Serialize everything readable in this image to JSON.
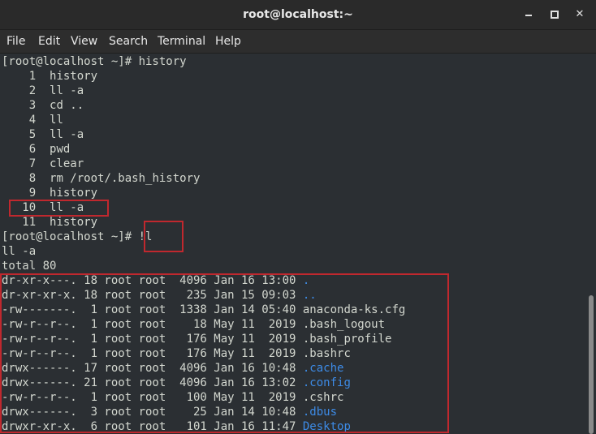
{
  "window": {
    "title": "root@localhost:~"
  },
  "menu": [
    "File",
    "Edit",
    "View",
    "Search",
    "Terminal",
    "Help"
  ],
  "terminal": {
    "prompt_history": "[root@localhost ~]# history",
    "history": [
      {
        "num": "1",
        "cmd": "history"
      },
      {
        "num": "2",
        "cmd": "ll -a"
      },
      {
        "num": "3",
        "cmd": "cd .."
      },
      {
        "num": "4",
        "cmd": "ll"
      },
      {
        "num": "5",
        "cmd": "ll -a"
      },
      {
        "num": "6",
        "cmd": "pwd"
      },
      {
        "num": "7",
        "cmd": "clear"
      },
      {
        "num": "8",
        "cmd": "rm /root/.bash_history"
      },
      {
        "num": "9",
        "cmd": "history"
      },
      {
        "num": "10",
        "cmd": "ll -a"
      },
      {
        "num": "11",
        "cmd": "history"
      }
    ],
    "prompt_bang": "[root@localhost ~]# ",
    "bang_cmd": "!l",
    "echo": "ll -a",
    "total": "total 80",
    "listing": [
      {
        "perm": "dr-xr-x---.",
        "links": "18",
        "user": "root",
        "group": "root",
        "size": "4096",
        "month": "Jan",
        "day": "16",
        "time": "13:00",
        "name": ".",
        "dir": true
      },
      {
        "perm": "dr-xr-xr-x.",
        "links": "18",
        "user": "root",
        "group": "root",
        "size": "235",
        "month": "Jan",
        "day": "15",
        "time": "09:03",
        "name": "..",
        "dir": true
      },
      {
        "perm": "-rw-------.",
        "links": "1",
        "user": "root",
        "group": "root",
        "size": "1338",
        "month": "Jan",
        "day": "14",
        "time": "05:40",
        "name": "anaconda-ks.cfg",
        "dir": false
      },
      {
        "perm": "-rw-r--r--.",
        "links": "1",
        "user": "root",
        "group": "root",
        "size": "18",
        "month": "May",
        "day": "11",
        "time": "2019",
        "name": ".bash_logout",
        "dir": false
      },
      {
        "perm": "-rw-r--r--.",
        "links": "1",
        "user": "root",
        "group": "root",
        "size": "176",
        "month": "May",
        "day": "11",
        "time": "2019",
        "name": ".bash_profile",
        "dir": false
      },
      {
        "perm": "-rw-r--r--.",
        "links": "1",
        "user": "root",
        "group": "root",
        "size": "176",
        "month": "May",
        "day": "11",
        "time": "2019",
        "name": ".bashrc",
        "dir": false
      },
      {
        "perm": "drwx------.",
        "links": "17",
        "user": "root",
        "group": "root",
        "size": "4096",
        "month": "Jan",
        "day": "16",
        "time": "10:48",
        "name": ".cache",
        "dir": true
      },
      {
        "perm": "drwx------.",
        "links": "21",
        "user": "root",
        "group": "root",
        "size": "4096",
        "month": "Jan",
        "day": "16",
        "time": "13:02",
        "name": ".config",
        "dir": true
      },
      {
        "perm": "-rw-r--r--.",
        "links": "1",
        "user": "root",
        "group": "root",
        "size": "100",
        "month": "May",
        "day": "11",
        "time": "2019",
        "name": ".cshrc",
        "dir": false
      },
      {
        "perm": "drwx------.",
        "links": "3",
        "user": "root",
        "group": "root",
        "size": "25",
        "month": "Jan",
        "day": "14",
        "time": "10:48",
        "name": ".dbus",
        "dir": true
      },
      {
        "perm": "drwxr-xr-x.",
        "links": "6",
        "user": "root",
        "group": "root",
        "size": "101",
        "month": "Jan",
        "day": "16",
        "time": "11:47",
        "name": "Desktop",
        "dir": true
      }
    ]
  },
  "colors": {
    "background": "#2b2f33",
    "text": "#d3d7cf",
    "directory": "#3d8be6",
    "highlight": "#c0282e"
  }
}
